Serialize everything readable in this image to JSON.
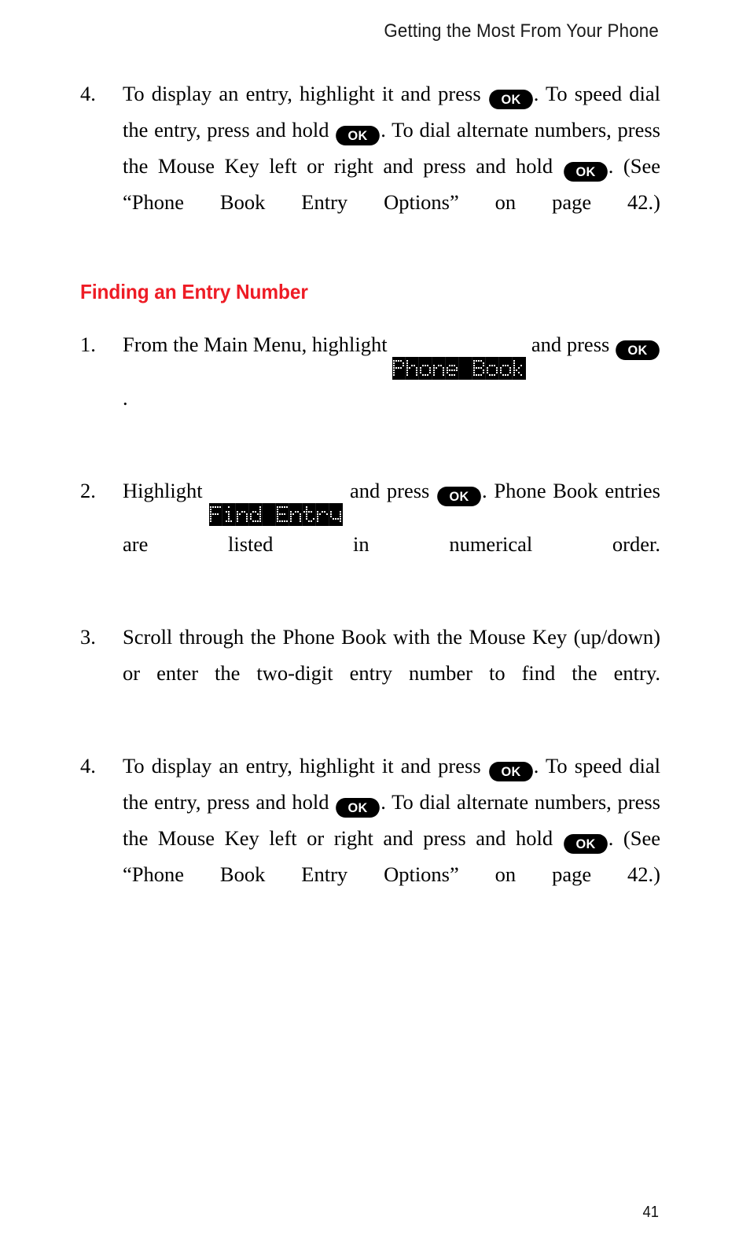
{
  "header": {
    "running_title": "Getting the Most From Your Phone"
  },
  "colors": {
    "heading_red": "#ee1c25",
    "lcd_background": "#000000",
    "lcd_pixel": "#ffffff",
    "key_background": "#000000",
    "key_label": "#ffffff"
  },
  "keys": {
    "ok_label": "OK"
  },
  "lcd_labels": {
    "phone_book": "Phone Book",
    "find_entry": "Find Entry"
  },
  "blocks": [
    {
      "id": "step-4-top",
      "number": "4.",
      "segments": [
        {
          "type": "text",
          "value": "To display an entry, highlight it and press "
        },
        {
          "type": "key",
          "value": "OK"
        },
        {
          "type": "text",
          "value": ". To speed dial the entry, press and hold "
        },
        {
          "type": "key",
          "value": "OK"
        },
        {
          "type": "text",
          "value": ". To dial alternate numbers, press the Mouse Key left or right and press and hold "
        },
        {
          "type": "key",
          "value": "OK"
        },
        {
          "type": "text",
          "value": ". (See “Phone Book Entry Options” on page 42.)"
        }
      ]
    }
  ],
  "section": {
    "heading": "Finding an Entry Number",
    "steps": [
      {
        "id": "step-1",
        "number": "1.",
        "segments": [
          {
            "type": "text",
            "value": "From the Main Menu, highlight "
          },
          {
            "type": "lcd",
            "value": "Phone Book"
          },
          {
            "type": "text",
            "value": " and press "
          },
          {
            "type": "key",
            "value": "OK"
          },
          {
            "type": "text",
            "value": "."
          }
        ]
      },
      {
        "id": "step-2",
        "number": "2.",
        "segments": [
          {
            "type": "text",
            "value": "Highlight "
          },
          {
            "type": "lcd",
            "value": "Find Entry"
          },
          {
            "type": "text",
            "value": " and press "
          },
          {
            "type": "key",
            "value": "OK"
          },
          {
            "type": "text",
            "value": ". Phone Book entries are listed in numerical order."
          }
        ]
      },
      {
        "id": "step-3",
        "number": "3.",
        "segments": [
          {
            "type": "text",
            "value": "Scroll through the Phone Book with the Mouse Key (up/down) or enter the two-digit entry number to find the entry."
          }
        ]
      },
      {
        "id": "step-4-bottom",
        "number": "4.",
        "segments": [
          {
            "type": "text",
            "value": "To display an entry, highlight it and press "
          },
          {
            "type": "key",
            "value": "OK"
          },
          {
            "type": "text",
            "value": ". To speed dial the entry, press and hold "
          },
          {
            "type": "key",
            "value": "OK"
          },
          {
            "type": "text",
            "value": ". To dial alternate numbers, press the Mouse Key left or right and press and hold "
          },
          {
            "type": "key",
            "value": "OK"
          },
          {
            "type": "text",
            "value": ". (See “Phone Book Entry Options” on page 42.)"
          }
        ]
      }
    ]
  },
  "footer": {
    "page_number": "41"
  }
}
